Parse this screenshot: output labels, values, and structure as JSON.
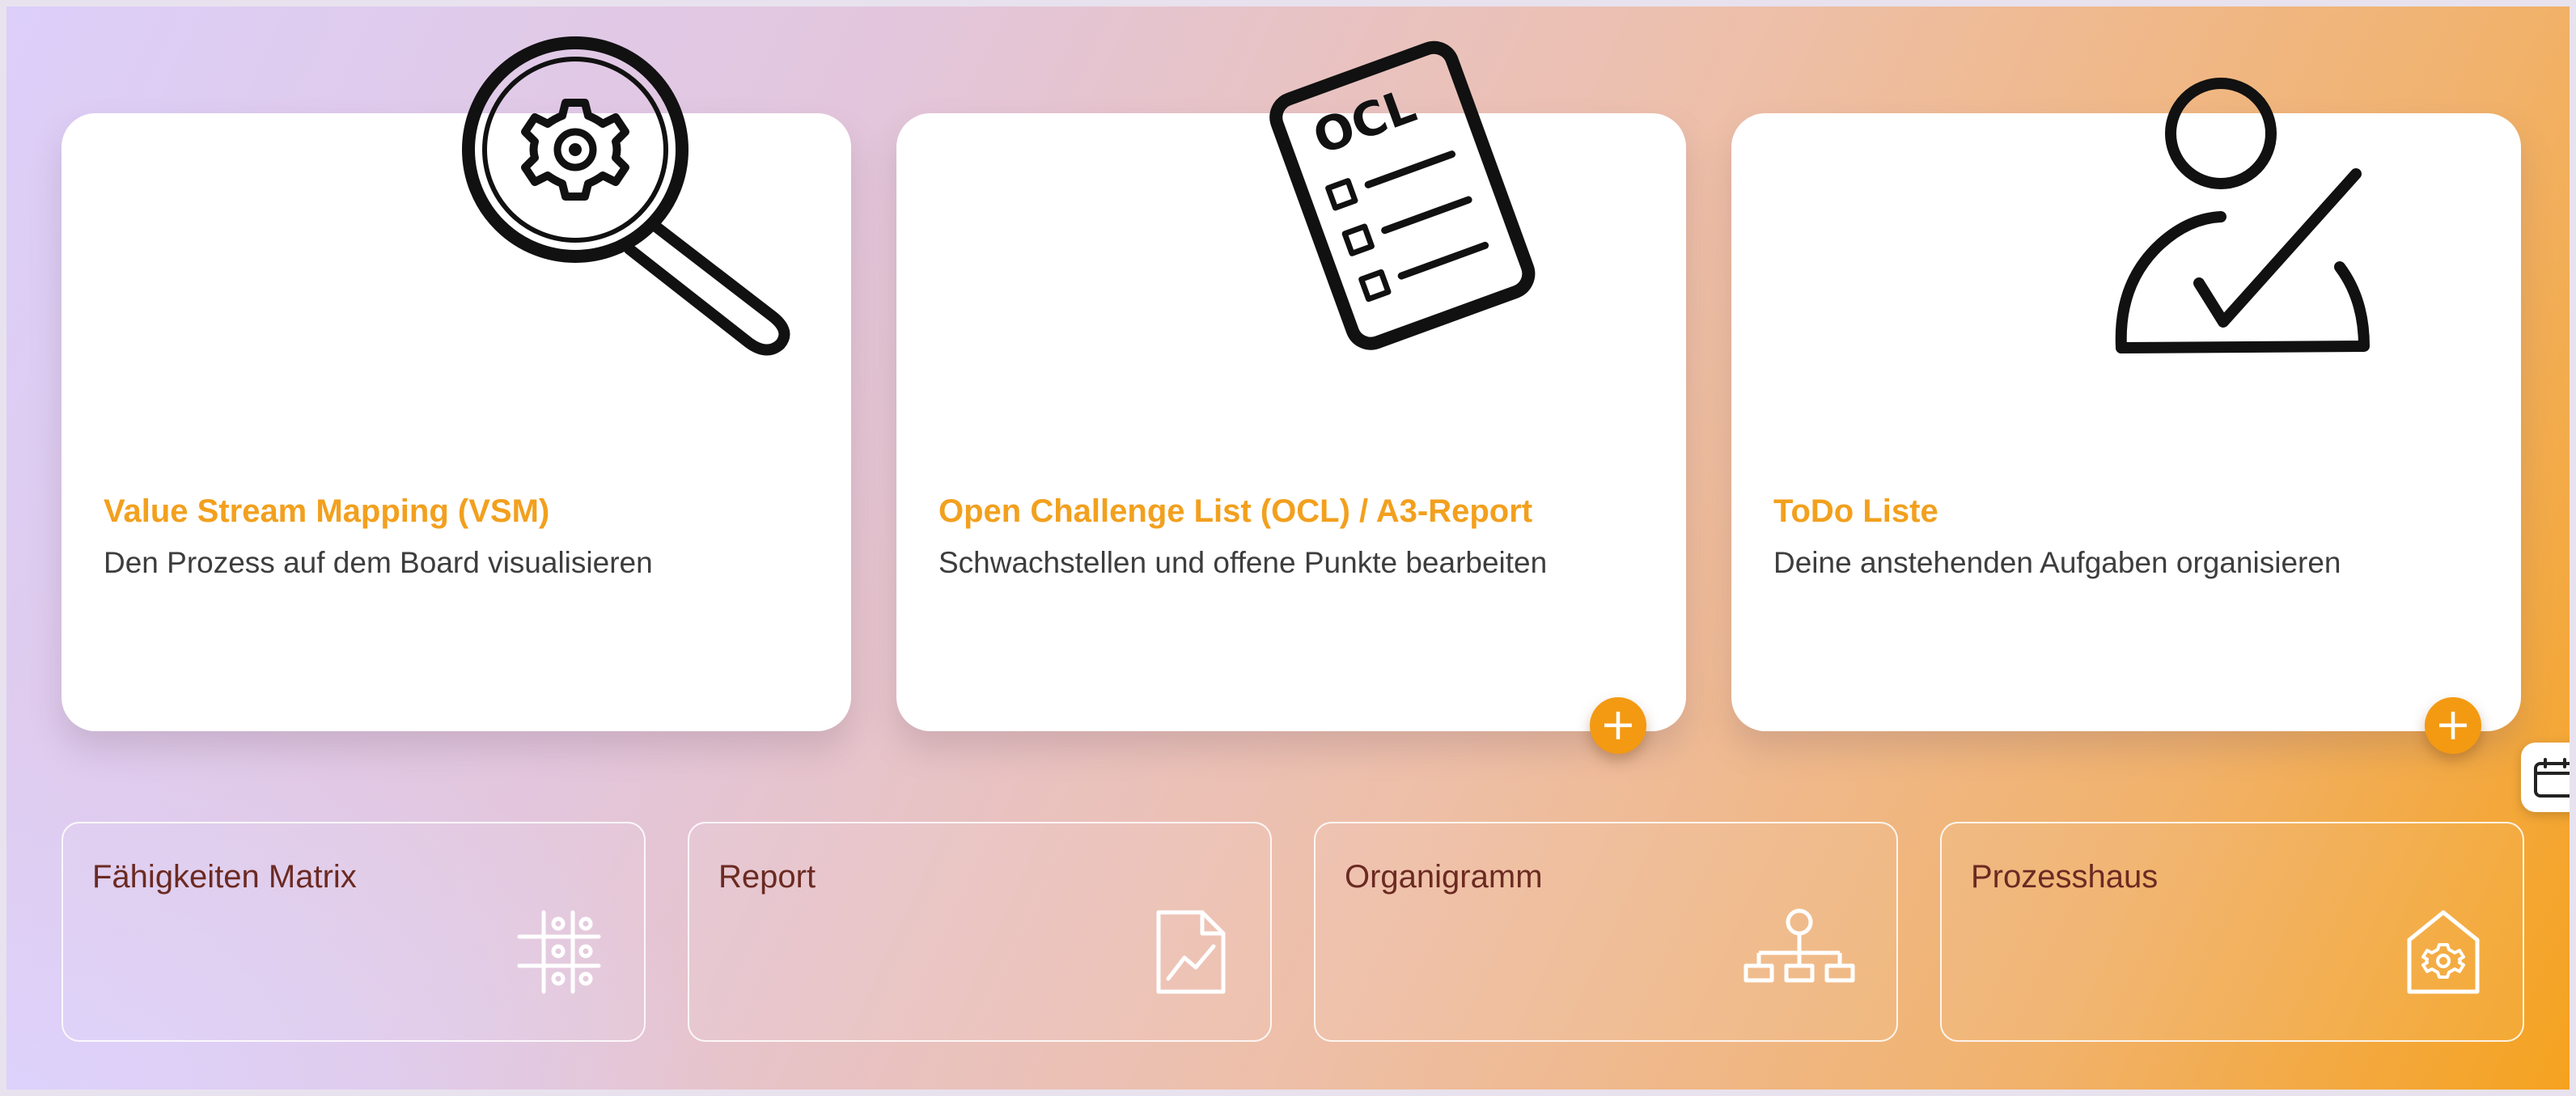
{
  "cards": [
    {
      "title": "Value Stream Mapping (VSM)",
      "subtitle": "Den Prozess auf dem Board visualisieren",
      "icon": "magnifier-gear-icon"
    },
    {
      "title": "Open Challenge List (OCL) / A3-Report",
      "subtitle": "Schwachstellen und offene Punkte bearbeiten",
      "icon": "ocl-checklist-icon",
      "illustration_text": "OCL",
      "add_label": "+"
    },
    {
      "title": "ToDo Liste",
      "subtitle": "Deine anstehenden Aufgaben organisieren",
      "icon": "person-check-icon",
      "add_label": "+"
    }
  ],
  "tiles": [
    {
      "label": "Fähigkeiten Matrix",
      "icon": "matrix-grid-icon"
    },
    {
      "label": "Report",
      "icon": "report-chart-icon"
    },
    {
      "label": "Organigramm",
      "icon": "org-chart-icon"
    },
    {
      "label": "Prozesshaus",
      "icon": "process-house-icon"
    }
  ],
  "side_button": {
    "icon": "calendar-icon"
  },
  "colors": {
    "accent": "#f39a12",
    "card_title": "#f2a01e",
    "tile_text": "#6b2a22",
    "card_text": "#3d3d3d"
  }
}
